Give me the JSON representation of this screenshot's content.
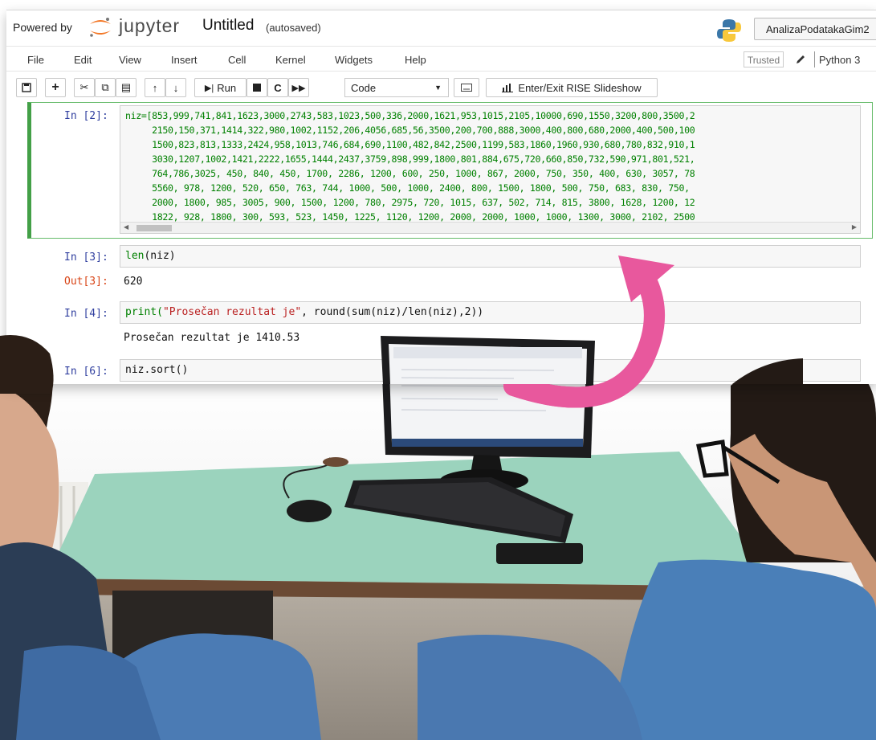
{
  "header": {
    "powered_by": "Powered by",
    "brand": "jupyter",
    "notebook_title": "Untitled",
    "autosave_status": "(autosaved)",
    "user": "AnalizaPodatakaGim2"
  },
  "menu": {
    "items": [
      "File",
      "Edit",
      "View",
      "Insert",
      "Cell",
      "Kernel",
      "Widgets",
      "Help"
    ],
    "trusted": "Trusted",
    "kernel": "Python 3"
  },
  "toolbar": {
    "run_label": "Run",
    "cell_type": "Code",
    "rise_label": "Enter/Exit RISE Slideshow"
  },
  "cells": {
    "in2": {
      "prompt": "In [2]:",
      "lines": [
        "niz=[853,999,741,841,1623,3000,2743,583,1023,500,336,2000,1621,953,1015,2105,10000,690,1550,3200,800,3500,2",
        "     2150,150,371,1414,322,980,1002,1152,206,4056,685,56,3500,200,700,888,3000,400,800,680,2000,400,500,100",
        "     1500,823,813,1333,2424,958,1013,746,684,690,1100,482,842,2500,1199,583,1860,1960,930,680,780,832,910,1",
        "     3030,1207,1002,1421,2222,1655,1444,2437,3759,898,999,1800,801,884,675,720,660,850,732,590,971,801,521,",
        "     764,786,3025, 450, 840, 450, 1700, 2286, 1200, 600, 250, 1000, 867, 2000, 750, 350, 400, 630, 3057, 78",
        "     5560, 978, 1200, 520, 650, 763, 744, 1000, 500, 1000, 2400, 800, 1500, 1800, 500, 750, 683, 830, 750,",
        "     2000, 1800, 985, 3005, 900, 1500, 1200, 780, 2975, 720, 1015, 637, 502, 714, 815, 3800, 1628, 1200, 12",
        "     1822, 928, 1800, 300, 593, 523, 1450, 1225, 1120, 1200, 2000, 2000, 1000, 1000, 1300, 3000, 2102, 2500"
      ]
    },
    "in3": {
      "prompt": "In [3]:",
      "code_fn": "len",
      "code_arg": "(niz)",
      "out_prompt": "Out[3]:",
      "output": "620"
    },
    "in4": {
      "prompt": "In [4]:",
      "code_print": "print(",
      "code_string": "\"Prosečan rezultat je\"",
      "code_rest": ", round(sum(niz)/len(niz),2))",
      "output": "Prosečan rezultat je 1410.53"
    },
    "in6": {
      "prompt": "In [6]:",
      "code": "niz.sort()"
    }
  },
  "colors": {
    "arrow": "#e8589d",
    "desk": "#93cdb7",
    "jeans": "#4a78b0",
    "sweater": "#4a7fb8"
  }
}
